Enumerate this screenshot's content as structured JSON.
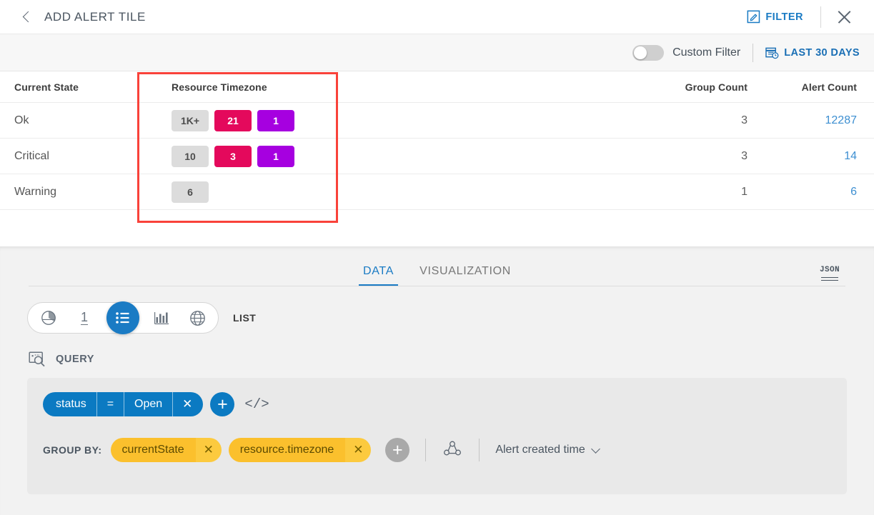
{
  "header": {
    "back_icon": "chevron-left-icon",
    "title": "ADD ALERT TILE",
    "filter_label": "FILTER",
    "filter_icon": "edit-pencil-square-icon",
    "close_icon": "close-icon"
  },
  "subbar": {
    "toggle_state": "off",
    "toggle_label": "Custom Filter",
    "daterange_icon": "calendar-clock-icon",
    "daterange_label": "LAST 30 DAYS"
  },
  "table": {
    "columns": [
      "Current State",
      "Resource Timezone",
      "Group Count",
      "Alert Count"
    ],
    "rows": [
      {
        "current_state": "Ok",
        "badges": [
          {
            "value": "1K+",
            "color": "#dcdcdc",
            "style": "grey"
          },
          {
            "value": "21",
            "color": "#e4095c",
            "style": "pink"
          },
          {
            "value": "1",
            "color": "#a600e0",
            "style": "purple"
          }
        ],
        "group_count": "3",
        "alert_count": "12287"
      },
      {
        "current_state": "Critical",
        "badges": [
          {
            "value": "10",
            "color": "#dcdcdc",
            "style": "grey"
          },
          {
            "value": "3",
            "color": "#e4095c",
            "style": "pink"
          },
          {
            "value": "1",
            "color": "#a600e0",
            "style": "purple"
          }
        ],
        "group_count": "3",
        "alert_count": "14"
      },
      {
        "current_state": "Warning",
        "badges": [
          {
            "value": "6",
            "color": "#dcdcdc",
            "style": "grey"
          }
        ],
        "group_count": "1",
        "alert_count": "6"
      }
    ],
    "highlight_color": "#f9423a"
  },
  "panel": {
    "tabs": [
      {
        "label": "DATA",
        "active": true
      },
      {
        "label": "VISUALIZATION",
        "active": false
      }
    ],
    "json_label": "JSON",
    "viz_types": [
      {
        "name": "pie-chart-icon",
        "active": false
      },
      {
        "name": "single-value-icon",
        "label": "1",
        "active": false
      },
      {
        "name": "list-icon",
        "active": true
      },
      {
        "name": "bar-chart-icon",
        "active": false
      },
      {
        "name": "globe-icon",
        "active": false
      }
    ],
    "viz_selected_label": "LIST",
    "query_icon": "query-search-icon",
    "query_label": "QUERY",
    "query": {
      "field": "status",
      "operator": "=",
      "value": "Open",
      "remove_icon": "close-icon",
      "add_label": "+",
      "code_icon": "code-brackets-icon"
    },
    "groupby": {
      "label": "GROUP BY:",
      "fields": [
        "currentState",
        "resource.timezone"
      ],
      "remove_icon": "close-icon",
      "add_label": "+",
      "node_icon": "node-graph-icon",
      "sort_field": "Alert created time",
      "sort_chevron": "chevron-down-icon"
    }
  }
}
